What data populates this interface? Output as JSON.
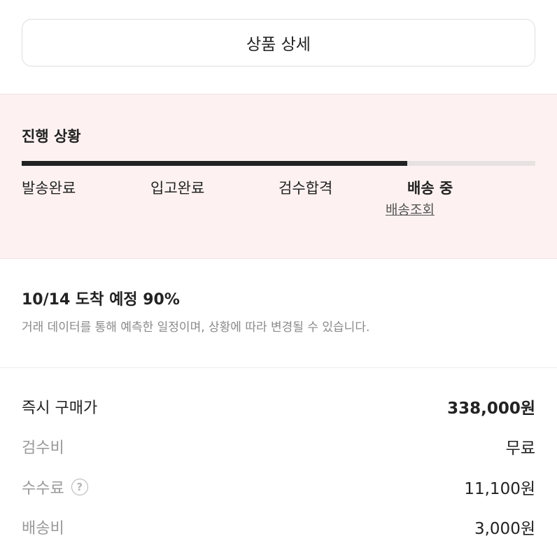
{
  "detail_button": {
    "label": "상품 상세"
  },
  "progress": {
    "title": "진행 상황",
    "fill_fraction": 0.75,
    "steps": [
      {
        "label": "발송완료",
        "active": false
      },
      {
        "label": "입고완료",
        "active": false
      },
      {
        "label": "검수합격",
        "active": false
      },
      {
        "label": "배송 중",
        "active": true
      }
    ],
    "tracking_link": "배송조회"
  },
  "arrival": {
    "title": "10/14 도착 예정 90%",
    "note": "거래 데이터를 통해 예측한 일정이며, 상황에 따라 변경될 수 있습니다."
  },
  "prices": [
    {
      "label": "즉시 구매가",
      "value": "338,000원"
    },
    {
      "label": "검수비",
      "value": "무료"
    },
    {
      "label": "수수료",
      "value": "11,100원",
      "help_icon": "question-circle-icon",
      "help_glyph": "?"
    },
    {
      "label": "배송비",
      "value": "3,000원"
    }
  ]
}
